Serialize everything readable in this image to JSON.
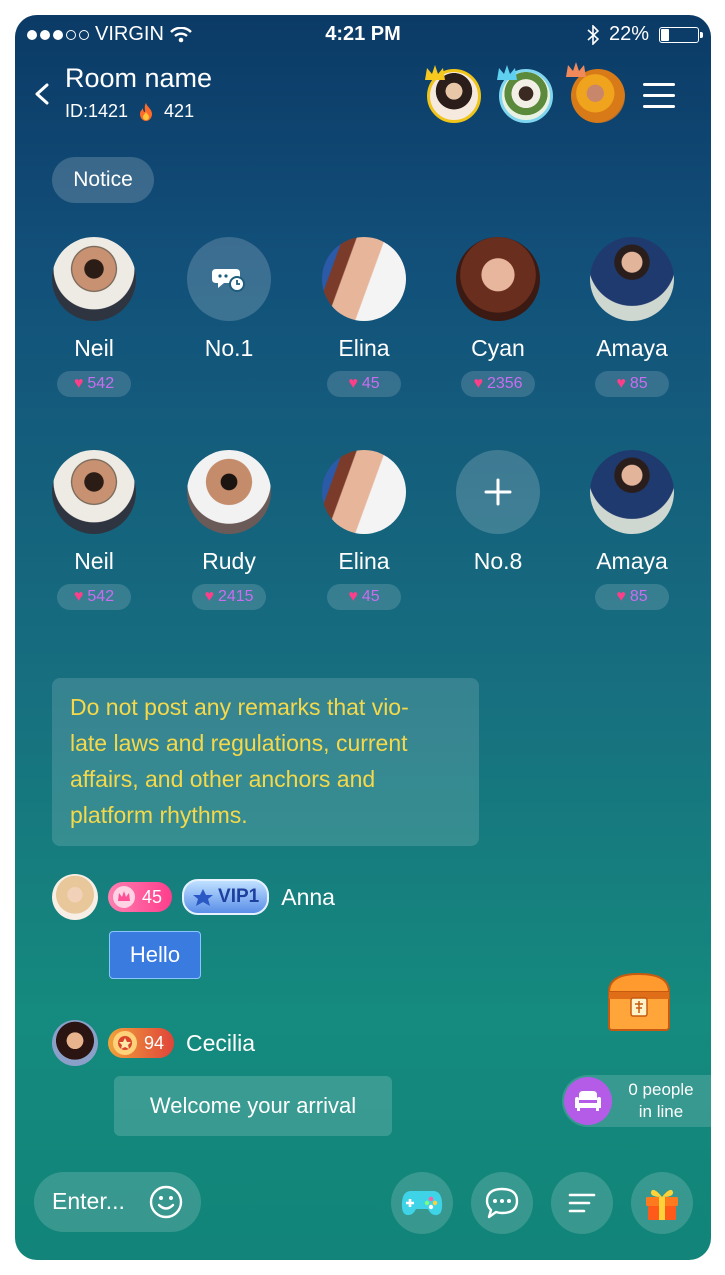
{
  "status_bar": {
    "carrier": "VIRGIN",
    "time": "4:21 PM",
    "battery": "22%",
    "battery_level": 0.22
  },
  "header": {
    "room_name": "Room name",
    "room_id": "ID:1421",
    "hot_count": "421"
  },
  "notice_label": "Notice",
  "seats_row1": [
    {
      "name": "Neil",
      "likes": "542",
      "type": "avatar",
      "avatar": "man-beard"
    },
    {
      "name": "No.1",
      "likes": "",
      "type": "empty",
      "icon": "chat-clock-icon"
    },
    {
      "name": "Elina",
      "likes": "45",
      "type": "avatar",
      "avatar": "woman-red"
    },
    {
      "name": "Cyan",
      "likes": "2356",
      "type": "avatar",
      "avatar": "woman-brown"
    },
    {
      "name": "Amaya",
      "likes": "85",
      "type": "avatar",
      "avatar": "girl-navy"
    }
  ],
  "seats_row2": [
    {
      "name": "Neil",
      "likes": "542",
      "type": "avatar",
      "avatar": "man-beard"
    },
    {
      "name": "Rudy",
      "likes": "2415",
      "type": "avatar",
      "avatar": "man-shirt"
    },
    {
      "name": "Elina",
      "likes": "45",
      "type": "avatar",
      "avatar": "woman-red"
    },
    {
      "name": "No.8",
      "likes": "",
      "type": "empty",
      "icon": "plus-icon"
    },
    {
      "name": "Amaya",
      "likes": "85",
      "type": "avatar",
      "avatar": "girl-navy"
    }
  ],
  "rules_lines": [
    "Do not post any remarks that vio-",
    "late laws and regulations, current",
    "affairs, and other anchors and",
    "platform rhythms."
  ],
  "messages": [
    {
      "user": "Anna",
      "level": "45",
      "vip": "VIP1",
      "text": "Hello"
    },
    {
      "user": "Cecilia",
      "level": "94",
      "text": "Welcome your arrival"
    }
  ],
  "queue": {
    "line1": "0 people",
    "line2": "in line"
  },
  "input_placeholder": "Enter...",
  "colors": {
    "rules_text": "#f5d94a",
    "heart": "#ff3e8a",
    "like_count": "#c96df0",
    "queue_circle": "#b45ce8"
  }
}
